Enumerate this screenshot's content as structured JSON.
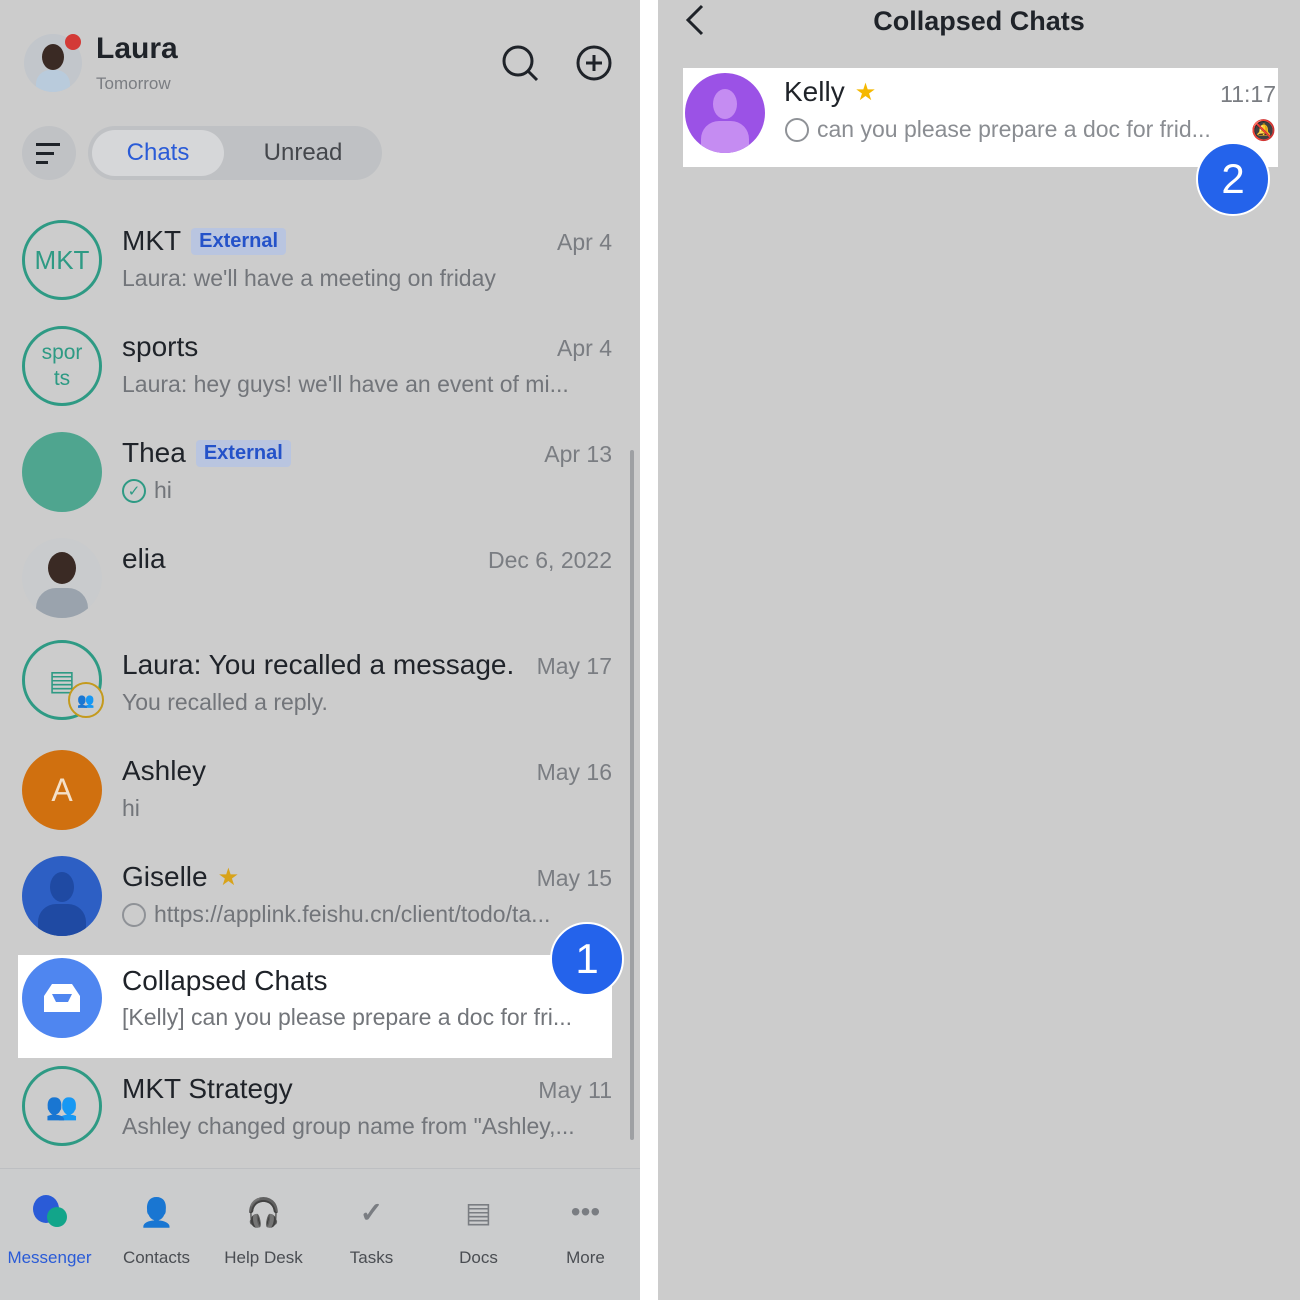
{
  "header": {
    "user_name": "Laura",
    "status": "Tomorrow"
  },
  "tabs": [
    {
      "label": "Chats",
      "active": true
    },
    {
      "label": "Unread",
      "active": false
    }
  ],
  "chats": [
    {
      "name": "MKT",
      "avatar_text": "MKT",
      "tag": "External",
      "time": "Apr 4",
      "message": "Laura: we'll have a meeting on friday"
    },
    {
      "name": "sports",
      "avatar_text": "spor ts",
      "time": "Apr 4",
      "message": "Laura: hey guys! we'll have an event of mi..."
    },
    {
      "name": "Thea",
      "tag": "External",
      "time": "Apr 13",
      "message": "hi"
    },
    {
      "name": "elia",
      "time": "Dec 6, 2022",
      "message": ""
    },
    {
      "name": "Laura: You recalled a message.",
      "time": "May 17",
      "message": "You recalled a reply."
    },
    {
      "name": "Ashley",
      "avatar_text": "A",
      "time": "May 16",
      "message": "hi"
    },
    {
      "name": "Giselle",
      "time": "May 15",
      "message": "https://applink.feishu.cn/client/todo/ta..."
    },
    {
      "name": "Collapsed Chats",
      "time": "",
      "message": "[Kelly] can you please prepare a doc for fri..."
    },
    {
      "name": "MKT Strategy",
      "time": "May 11",
      "message": "Ashley changed group name from \"Ashley,..."
    }
  ],
  "nav": [
    {
      "label": "Messenger",
      "active": true
    },
    {
      "label": "Contacts"
    },
    {
      "label": "Help Desk"
    },
    {
      "label": "Tasks"
    },
    {
      "label": "Docs"
    },
    {
      "label": "More"
    }
  ],
  "right": {
    "title": "Collapsed Chats",
    "chat": {
      "name": "Kelly",
      "time": "11:17",
      "message": "can you please prepare a doc for frid..."
    }
  },
  "steps": [
    "1",
    "2"
  ],
  "colors": {
    "accent": "#2463eb",
    "teal": "#2e9a84",
    "highlight": "#ffffff"
  }
}
